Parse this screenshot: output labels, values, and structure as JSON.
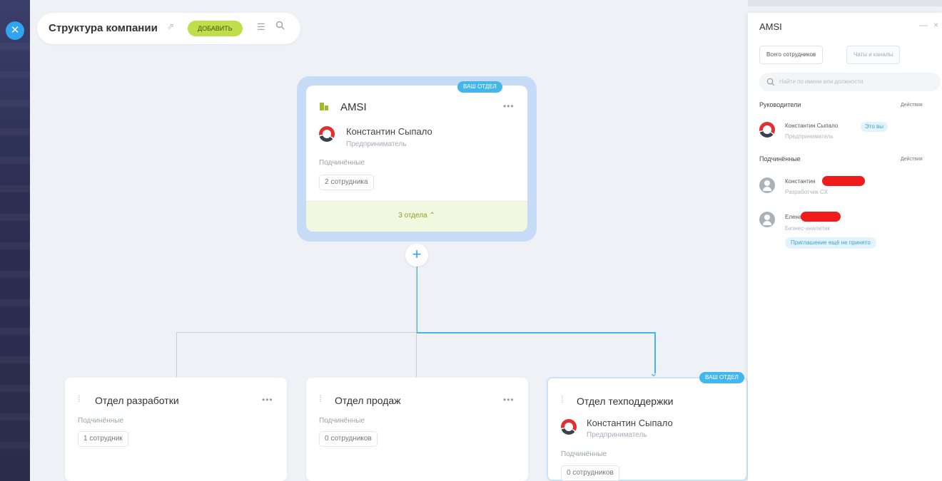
{
  "header": {
    "title": "Структура компании",
    "add_label": "добавить"
  },
  "root": {
    "badge": "ваш отдел",
    "name": "AMSI",
    "head_name": "Константин Сыпало",
    "head_role": "Предприниматель",
    "subordinates_label": "Подчинённые",
    "subordinates_count": "2 сотрудника",
    "departments_toggle": "3 отдела"
  },
  "departments": [
    {
      "name": "Отдел разработки",
      "subordinates_label": "Подчинённые",
      "count": "1 сотрудник"
    },
    {
      "name": "Отдел продаж",
      "subordinates_label": "Подчинённые",
      "count": "0 сотрудников"
    },
    {
      "name": "Отдел техподдержки",
      "badge": "ваш отдел",
      "head_name": "Константин Сыпало",
      "head_role": "Предприниматель",
      "subordinates_label": "Подчинённые",
      "count": "0 сотрудников"
    }
  ],
  "panel": {
    "title": "AMSI",
    "tabs": [
      "Всего сотрудников",
      "Чаты и каналы"
    ],
    "search_placeholder": "Найти по имени или должности",
    "heads_label": "Руководители",
    "actions_label": "Действия",
    "heads": [
      {
        "name": "Константин Сыпало",
        "tag": "Это вы",
        "role": "Предприниматель"
      }
    ],
    "subordinates_label": "Подчинённые",
    "subordinates": [
      {
        "name": "Константин",
        "role": "Разработчик CX"
      },
      {
        "name": "Елена",
        "role": "Бизнес-аналитик",
        "tag": "Приглашение ещё не принято"
      }
    ]
  },
  "colors": {
    "accent": "#43b6ee",
    "add_button": "#bde04a",
    "redaction": "#f01c1c",
    "footer": "#f1f8e0"
  }
}
